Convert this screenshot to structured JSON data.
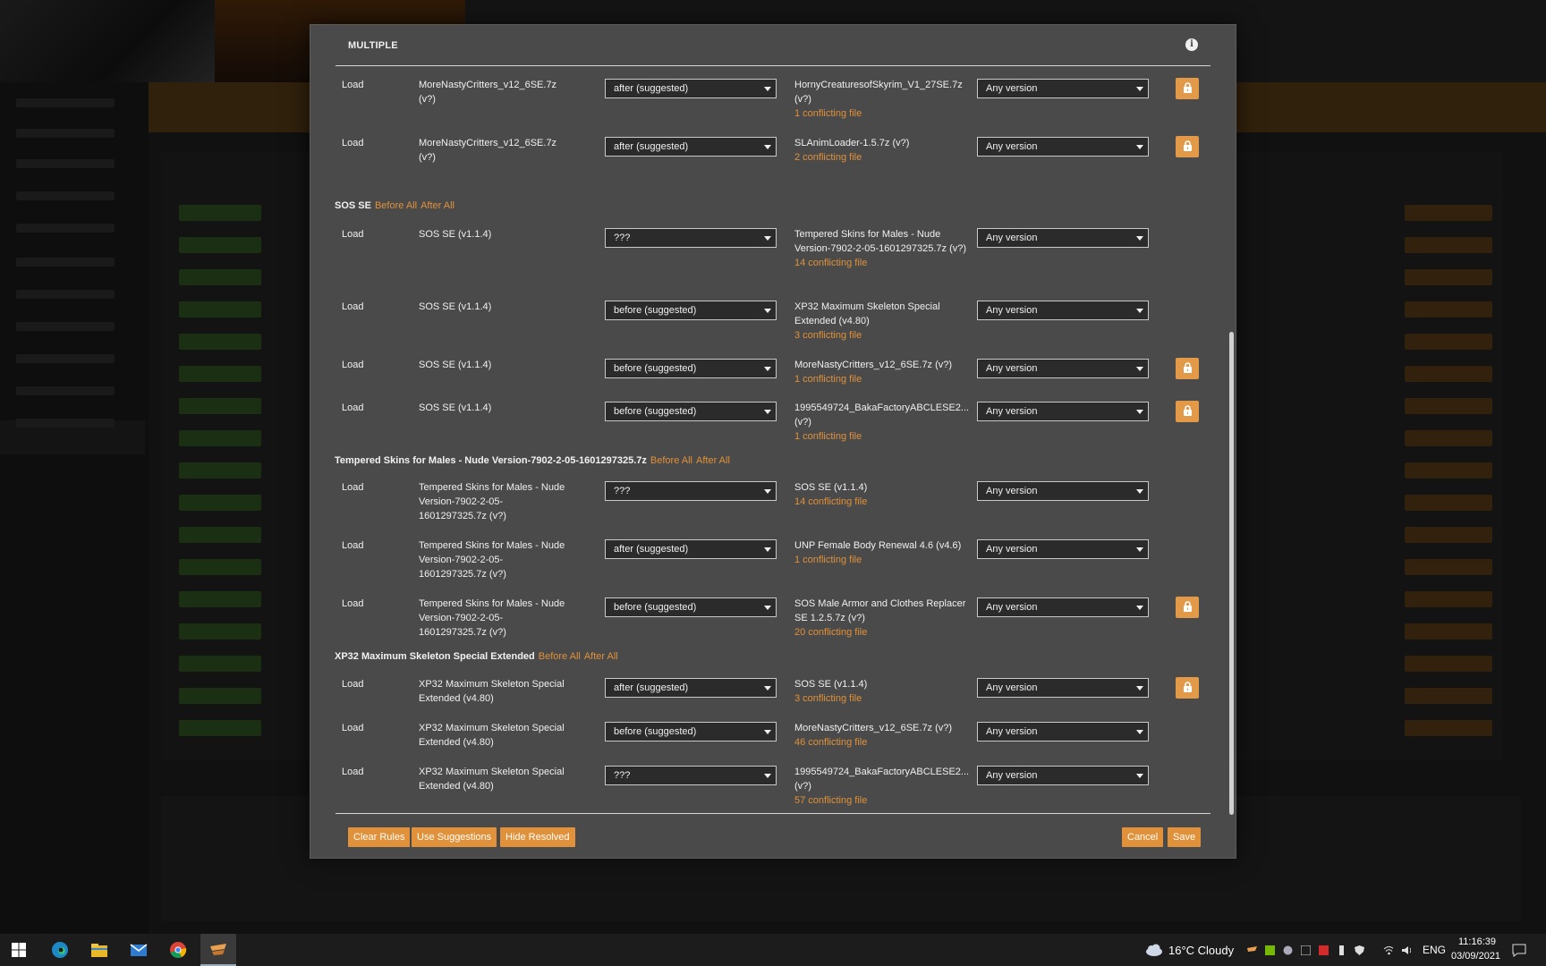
{
  "modal": {
    "title": "MULTIPLE",
    "link_before_all": "Before All",
    "link_after_all": "After All",
    "groups": [
      {
        "header": "SOS SE",
        "rules": []
      }
    ],
    "rows_top": [
      {
        "type": "Load",
        "mod": "MoreNastyCritters_v12_6SE.7z (v?)",
        "choice": "after (suggested)",
        "ref": "HornyCreaturesofSkyrim_V1_27SE.7z (v?)",
        "conflict": "1 conflicting file",
        "version": "Any version",
        "locked": true
      },
      {
        "type": "Load",
        "mod": "MoreNastyCritters_v12_6SE.7z (v?)",
        "choice": "after (suggested)",
        "ref": "SLAnimLoader-1.5.7z (v?)",
        "conflict": "2 conflicting file",
        "version": "Any version",
        "locked": true
      }
    ],
    "group_sos": {
      "header": "SOS SE",
      "rows": [
        {
          "type": "Load",
          "mod": "SOS SE (v1.1.4)",
          "choice": "???",
          "ref": "Tempered Skins for Males - Nude Version-7902-2-05-1601297325.7z (v?)",
          "conflict": "14 conflicting file",
          "version": "Any version",
          "locked": false
        },
        {
          "type": "Load",
          "mod": "SOS SE (v1.1.4)",
          "choice": "before (suggested)",
          "ref": "XP32 Maximum Skeleton Special Extended (v4.80)",
          "conflict": "3 conflicting file",
          "version": "Any version",
          "locked": false
        },
        {
          "type": "Load",
          "mod": "SOS SE (v1.1.4)",
          "choice": "before (suggested)",
          "ref": "MoreNastyCritters_v12_6SE.7z (v?)",
          "conflict": "1 conflicting file",
          "version": "Any version",
          "locked": true
        },
        {
          "type": "Load",
          "mod": "SOS SE (v1.1.4)",
          "choice": "before (suggested)",
          "ref": "1995549724_BakaFactoryABCLESE2... (v?)",
          "conflict": "1 conflicting file",
          "version": "Any version",
          "locked": true
        }
      ]
    },
    "group_tempered": {
      "header": "Tempered Skins for Males - Nude Version-7902-2-05-1601297325.7z",
      "rows": [
        {
          "type": "Load",
          "mod": "Tempered Skins for Males - Nude Version-7902-2-05-1601297325.7z (v?)",
          "choice": "???",
          "ref": "SOS SE (v1.1.4)",
          "conflict": "14 conflicting file",
          "version": "Any version",
          "locked": false
        },
        {
          "type": "Load",
          "mod": "Tempered Skins for Males - Nude Version-7902-2-05-1601297325.7z (v?)",
          "choice": "after (suggested)",
          "ref": "UNP Female Body Renewal 4.6 (v4.6)",
          "conflict": "1 conflicting file",
          "version": "Any version",
          "locked": false
        },
        {
          "type": "Load",
          "mod": "Tempered Skins for Males - Nude Version-7902-2-05-1601297325.7z (v?)",
          "choice": "before (suggested)",
          "ref": "SOS Male Armor and Clothes Replacer SE 1.2.5.7z (v?)",
          "conflict": "20 conflicting file",
          "version": "Any version",
          "locked": true
        }
      ]
    },
    "group_xp32": {
      "header": "XP32 Maximum Skeleton Special Extended",
      "rows": [
        {
          "type": "Load",
          "mod": "XP32 Maximum Skeleton Special Extended (v4.80)",
          "choice": "after (suggested)",
          "ref": "SOS SE (v1.1.4)",
          "conflict": "3 conflicting file",
          "version": "Any version",
          "locked": true
        },
        {
          "type": "Load",
          "mod": "XP32 Maximum Skeleton Special Extended (v4.80)",
          "choice": "before (suggested)",
          "ref": "MoreNastyCritters_v12_6SE.7z (v?)",
          "conflict": "46 conflicting file",
          "version": "Any version",
          "locked": false
        },
        {
          "type": "Load",
          "mod": "XP32 Maximum Skeleton Special Extended (v4.80)",
          "choice": "???",
          "ref": "1995549724_BakaFactoryABCLESE2... (v?)",
          "conflict": "57 conflicting file",
          "version": "Any version",
          "locked": false
        }
      ]
    },
    "buttons": {
      "clear_rules": "Clear Rules",
      "use_suggestions": "Use Suggestions",
      "hide_resolved": "Hide Resolved",
      "cancel": "Cancel",
      "save": "Save"
    }
  },
  "taskbar": {
    "weather": "16°C  Cloudy",
    "language": "ENG",
    "time": "11:16:39",
    "date": "03/09/2021"
  },
  "colors": {
    "accent": "#e0913a",
    "modal_bg": "#4a4a4a",
    "select_bg": "#2b2b2b"
  }
}
